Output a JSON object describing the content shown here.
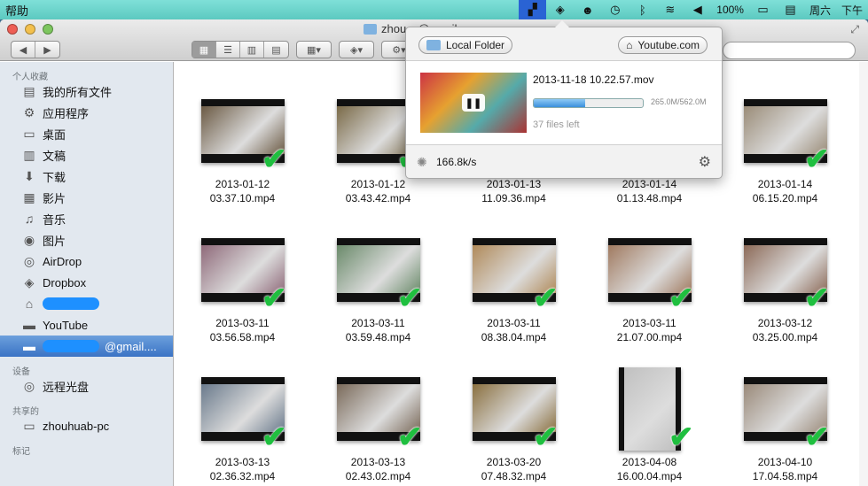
{
  "menubar": {
    "app_menu": "帮助",
    "battery": "100%",
    "day": "周六",
    "time_fragment": "下午"
  },
  "window": {
    "title": "zhou…@gmail…"
  },
  "sidebar": {
    "favorites_header": "个人收藏",
    "items": [
      {
        "label": "我的所有文件",
        "icon": "all-files-icon",
        "glyph": "▤"
      },
      {
        "label": "应用程序",
        "icon": "applications-icon",
        "glyph": "⚙"
      },
      {
        "label": "桌面",
        "icon": "desktop-icon",
        "glyph": "▭"
      },
      {
        "label": "文稿",
        "icon": "documents-icon",
        "glyph": "▥"
      },
      {
        "label": "下载",
        "icon": "downloads-icon",
        "glyph": "⬇"
      },
      {
        "label": "影片",
        "icon": "movies-icon",
        "glyph": "▦"
      },
      {
        "label": "音乐",
        "icon": "music-icon",
        "glyph": "♫"
      },
      {
        "label": "图片",
        "icon": "pictures-icon",
        "glyph": "◉"
      },
      {
        "label": "AirDrop",
        "icon": "airdrop-icon",
        "glyph": "◎"
      },
      {
        "label": "Dropbox",
        "icon": "dropbox-icon",
        "glyph": "◈"
      },
      {
        "label": "",
        "icon": "home-icon",
        "glyph": "⌂"
      },
      {
        "label": "YouTube",
        "icon": "folder-icon",
        "glyph": "▬"
      },
      {
        "label": "@gmail....",
        "icon": "folder-icon",
        "glyph": "▬"
      }
    ],
    "devices_header": "设备",
    "devices": [
      {
        "label": "远程光盘",
        "icon": "disc-icon",
        "glyph": "◎"
      }
    ],
    "shared_header": "共享的",
    "shared": [
      {
        "label": "zhouhuab-pc",
        "icon": "computer-icon",
        "glyph": "▭"
      }
    ],
    "tags_header": "标记"
  },
  "files": [
    {
      "name1": "2013-01-12",
      "name2": "03.37.10.mp4",
      "color": "#6b5a44"
    },
    {
      "name1": "2013-01-12",
      "name2": "03.43.42.mp4",
      "color": "#7a6a48"
    },
    {
      "name1": "2013-01-13",
      "name2": "11.09.36.mp4",
      "color": "#8a7a5a"
    },
    {
      "name1": "2013-01-14",
      "name2": "01.13.48.mp4",
      "color": "#7d6b55"
    },
    {
      "name1": "2013-01-14",
      "name2": "06.15.20.mp4",
      "color": "#9a8c78"
    },
    {
      "name1": "2013-03-11",
      "name2": "03.56.58.mp4",
      "color": "#8f6a7a"
    },
    {
      "name1": "2013-03-11",
      "name2": "03.59.48.mp4",
      "color": "#6a8a6a"
    },
    {
      "name1": "2013-03-11",
      "name2": "08.38.04.mp4",
      "color": "#b08a5a"
    },
    {
      "name1": "2013-03-11",
      "name2": "21.07.00.mp4",
      "color": "#a07a60"
    },
    {
      "name1": "2013-03-12",
      "name2": "03.25.00.mp4",
      "color": "#8c6a58"
    },
    {
      "name1": "2013-03-13",
      "name2": "02.36.32.mp4",
      "color": "#6a7a8c"
    },
    {
      "name1": "2013-03-13",
      "name2": "02.43.02.mp4",
      "color": "#7a6a5a"
    },
    {
      "name1": "2013-03-20",
      "name2": "07.48.32.mp4",
      "color": "#8a7040"
    },
    {
      "name1": "2013-04-08",
      "name2": "16.00.04.mp4",
      "color": "#c0c0c0",
      "tall": true
    },
    {
      "name1": "2013-04-10",
      "name2": "17.04.58.mp4",
      "color": "#9a8a7a"
    }
  ],
  "popover": {
    "local_folder": "Local Folder",
    "youtube": "Youtube.com",
    "file": "2013-11-18 10.22.57.mov",
    "progress": 0.47,
    "size": "265.0M/562.0M",
    "files_left": "37 files left",
    "speed": "166.8k/s"
  }
}
